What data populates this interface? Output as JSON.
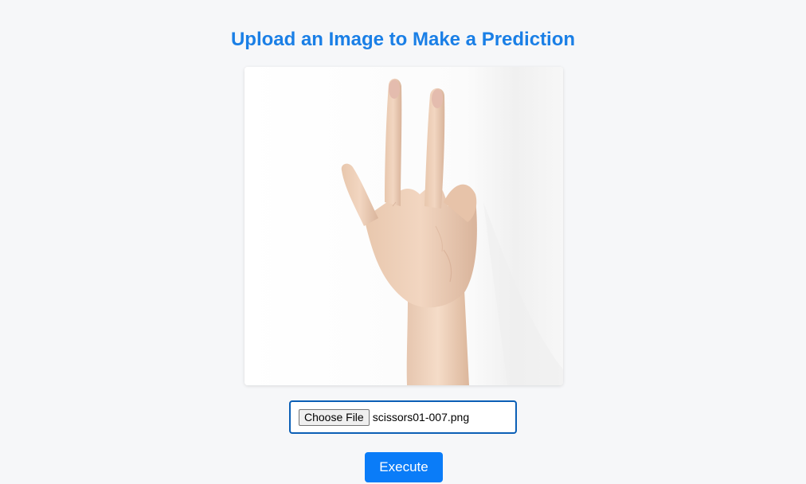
{
  "page": {
    "title": "Upload an Image to Make a Prediction"
  },
  "upload": {
    "choose_label": "Choose File",
    "file_name": "scissors01-007.png"
  },
  "actions": {
    "execute_label": "Execute"
  },
  "colors": {
    "title": "#1a7fe6",
    "accent": "#0a7cf8",
    "input_border": "#0b5fb6",
    "background": "#f6f7f9"
  }
}
